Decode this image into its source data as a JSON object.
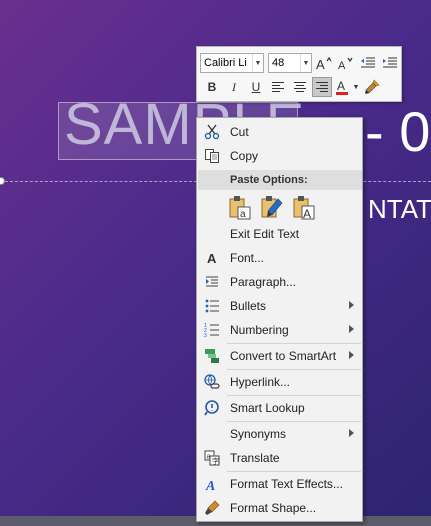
{
  "slide": {
    "title_left": "SAMPLE",
    "title_right": "- 0",
    "subtitle_right": "NTAT"
  },
  "mini_toolbar": {
    "font_name": "Calibri Li",
    "font_size": "48",
    "buttons_row1": [
      "increase-font-size",
      "decrease-font-size",
      "decrease-indent",
      "increase-indent"
    ],
    "bold_label": "B",
    "italic_label": "I",
    "underline_label": "U",
    "font_color": "#e02020",
    "font_color_letter": "A"
  },
  "context_menu": {
    "cut": "Cut",
    "copy": "Copy",
    "paste_options_header": "Paste Options:",
    "exit_edit_text": "Exit Edit Text",
    "font": "Font...",
    "paragraph": "Paragraph...",
    "bullets": "Bullets",
    "numbering": "Numbering",
    "convert_smartart": "Convert to SmartArt",
    "hyperlink": "Hyperlink...",
    "smart_lookup": "Smart Lookup",
    "synonyms": "Synonyms",
    "translate": "Translate",
    "format_text_effects": "Format Text Effects...",
    "format_shape": "Format Shape..."
  }
}
